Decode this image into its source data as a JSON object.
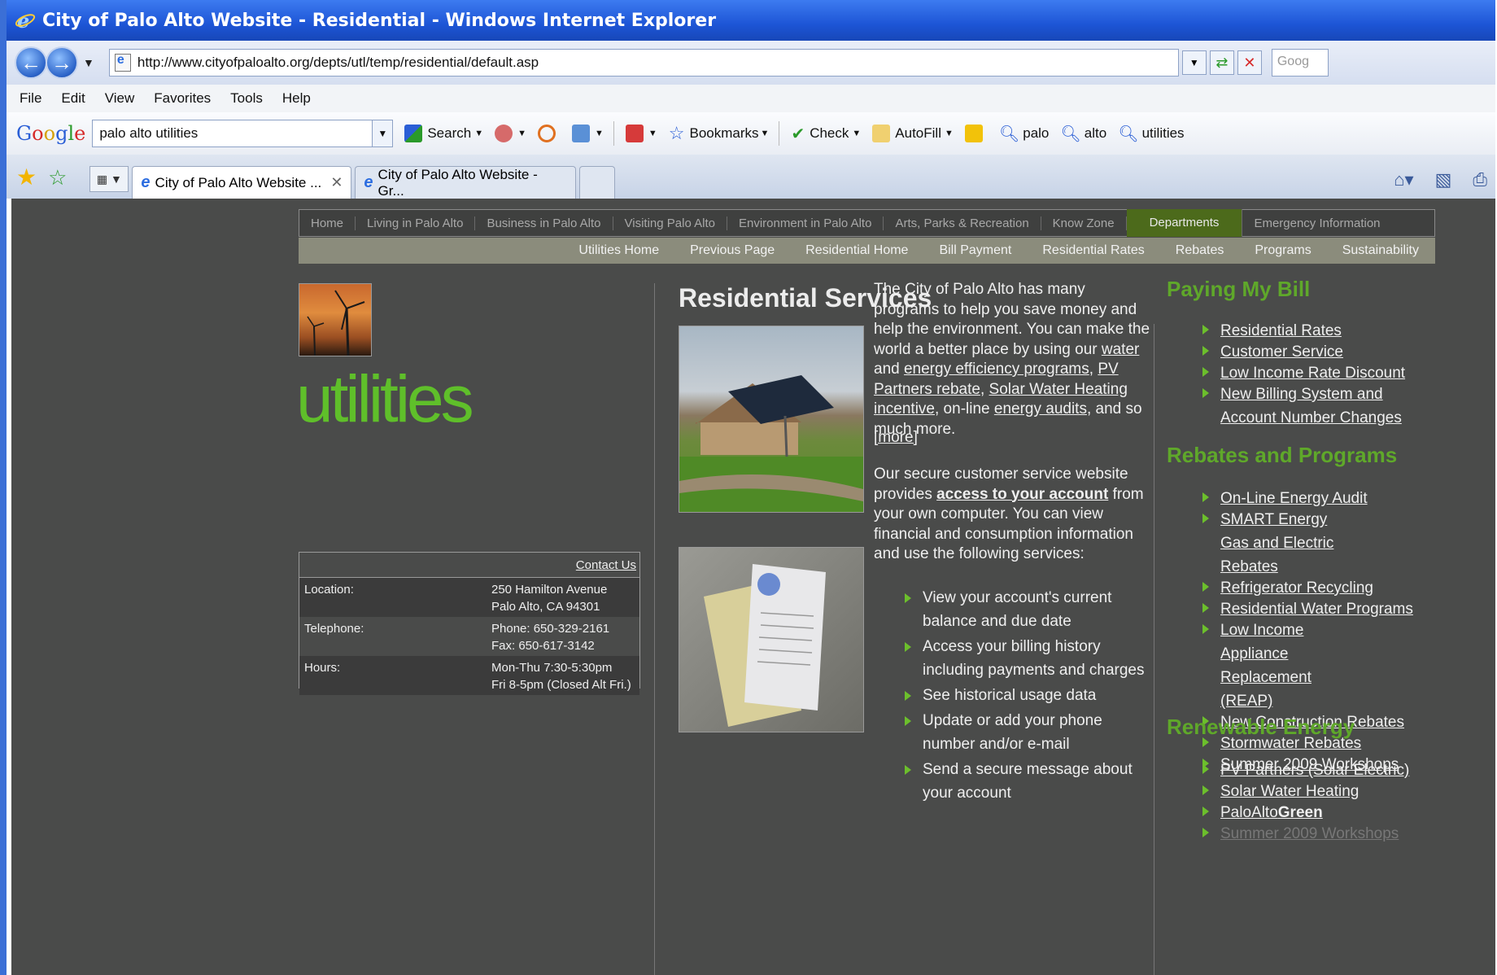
{
  "window": {
    "title": "City of Palo Alto Website - Residential - Windows Internet Explorer"
  },
  "address_bar": {
    "url": "http://www.cityofpaloalto.org/depts/utl/temp/residential/default.asp",
    "search_placeholder": "Goog"
  },
  "menu": [
    "File",
    "Edit",
    "View",
    "Favorites",
    "Tools",
    "Help"
  ],
  "google_toolbar": {
    "search_value": "palo alto utilities",
    "search_label": "Search",
    "bookmarks_label": "Bookmarks",
    "check_label": "Check",
    "autofill_label": "AutoFill",
    "terms": [
      "palo",
      "alto",
      "utilities"
    ]
  },
  "tabs": [
    {
      "label": "City of Palo Alto Website ..."
    },
    {
      "label": "City of Palo Alto Website - Gr..."
    }
  ],
  "site": {
    "top_nav": [
      "Home",
      "Living in Palo Alto",
      "Business in Palo Alto",
      "Visiting Palo Alto",
      "Environment in Palo Alto",
      "Arts, Parks & Recreation",
      "Know Zone",
      "Departments",
      "Emergency Information"
    ],
    "sub_nav": [
      "Utilities Home",
      "Previous Page",
      "Residential Home",
      "Bill Payment",
      "Residential Rates",
      "Rebates",
      "Programs",
      "Sustainability"
    ],
    "dept_word": "utilities",
    "contact": {
      "link": "Contact Us",
      "rows": [
        {
          "label": "Location:",
          "line1": "250 Hamilton Avenue",
          "line2": "Palo Alto, CA 94301"
        },
        {
          "label": "Telephone:",
          "line1": "Phone: 650-329-2161",
          "line2": "Fax: 650-617-3142"
        },
        {
          "label": "Hours:",
          "line1": "Mon-Thu 7:30-5:30pm",
          "line2": "Fri 8-5pm (Closed Alt Fri.)"
        }
      ]
    },
    "main": {
      "title": "Residential Services",
      "intro": {
        "t1": "The City of Palo Alto has many programs to help you save money and help the environment. You can make the world a better place by using our ",
        "l1": "water",
        "t2": " and ",
        "l2": "energy efficiency programs",
        "t3": ", ",
        "l3": "PV Partners rebate",
        "t4": ", ",
        "l4": "Solar Water Heating incentive",
        "t5": ", on-line ",
        "l5": "energy audits",
        "t6": ", and so much more."
      },
      "more": "[more]",
      "account": {
        "t1": "Our secure customer service website provides ",
        "l1": "access to your account",
        "t2": " from your own computer. You can view financial and consumption information and use  the following services:"
      },
      "services": [
        "View your account's current balance and due date",
        "Access your billing history including payments and charges",
        "See historical usage data",
        "Update or add your phone number and/or e-mail",
        "Send a secure message about your account"
      ]
    },
    "sidebar": {
      "paying": {
        "title": "Paying My Bill",
        "links": [
          "Residential Rates",
          "Customer Service",
          "Low Income Rate Discount",
          "New Billing System and Account Number Changes"
        ]
      },
      "rebates": {
        "title": "Rebates and Programs",
        "links": [
          "On-Line Energy Audit",
          "SMART Energy Gas and Electric Rebates",
          "Refrigerator Recycling",
          "Residential Water Programs",
          "Low Income Appliance Replacement (REAP)",
          "New Construction Rebates",
          "Stormwater Rebates",
          "Summer 2009 Workshops"
        ]
      },
      "renewable": {
        "title": "Renewable Energy",
        "links": [
          "PV Partners (Solar Electric)",
          "Solar Water Heating"
        ],
        "green_prefix": "PaloAlto",
        "green_bold": "Green",
        "cut_off": "Summer 2009 Workshops"
      }
    }
  }
}
